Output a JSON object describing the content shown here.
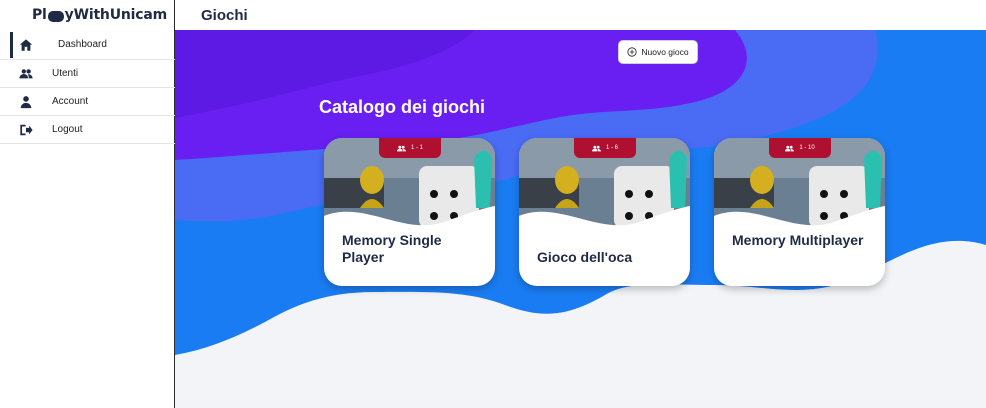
{
  "app": {
    "brand_pre": "Pl",
    "brand_post": "yWithUnicam"
  },
  "header": {
    "title": "Giochi"
  },
  "sidebar": {
    "items": [
      {
        "label": "Dashboard",
        "icon": "home-icon"
      },
      {
        "label": "Utenti",
        "icon": "users-icon"
      },
      {
        "label": "Account",
        "icon": "user-icon"
      },
      {
        "label": "Logout",
        "icon": "logout-icon"
      }
    ]
  },
  "toolbar": {
    "new_game_label": "Nuovo gioco",
    "new_game_icon": "plus-circle-icon"
  },
  "catalog": {
    "title": "Catalogo dei giochi",
    "cards": [
      {
        "title": "Memory Single Player",
        "players": "1 - 1"
      },
      {
        "title": "Gioco dell'oca",
        "players": "1 - 6"
      },
      {
        "title": "Memory Multiplayer",
        "players": "1 - 10"
      }
    ]
  },
  "colors": {
    "primary": "#1f2a44",
    "badge": "#b01030",
    "wave_purple": "#6a1ff2",
    "wave_blue": "#1a7cf2",
    "background": "#f2f4f8"
  }
}
